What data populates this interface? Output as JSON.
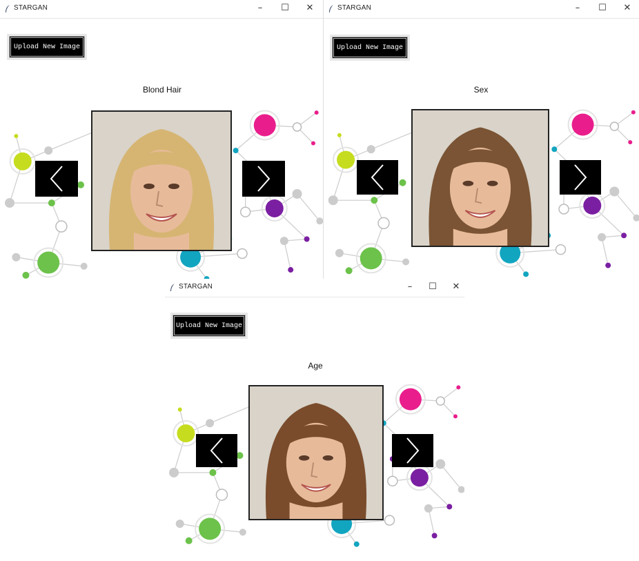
{
  "windows": [
    {
      "title": "STARGAN",
      "upload_label": "Upload New Image",
      "attribute_label": "Blond Hair",
      "prev_icon": "chevron-left-icon",
      "next_icon": "chevron-right-icon",
      "hair_color": "#d6b573",
      "minimize": "–",
      "maximize": "☐",
      "close": "✕"
    },
    {
      "title": "STARGAN",
      "upload_label": "Upload New Image",
      "attribute_label": "Sex",
      "prev_icon": "chevron-left-icon",
      "next_icon": "chevron-right-icon",
      "hair_color": "#7a5434",
      "minimize": "–",
      "maximize": "☐",
      "close": "✕"
    },
    {
      "title": "STARGAN",
      "upload_label": "Upload New Image",
      "attribute_label": "Age",
      "prev_icon": "chevron-left-icon",
      "next_icon": "chevron-right-icon",
      "hair_color": "#7a4c2c",
      "minimize": "–",
      "maximize": "☐",
      "close": "✕"
    }
  ],
  "accent_colors": {
    "pink": "#e91e8c",
    "purple": "#7b1fa2",
    "lime": "#c6dc1f",
    "green": "#6cc24a",
    "teal": "#12a5c0",
    "grey": "#bdbdbd"
  }
}
